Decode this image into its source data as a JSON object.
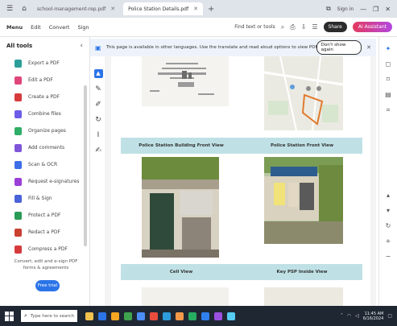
{
  "browser": {
    "tabs": [
      {
        "label": "school-management-rep.pdf",
        "active": false
      },
      {
        "label": "Police Station Details.pdf",
        "active": true
      }
    ],
    "new_tab": "+",
    "sign_in": "Sign in",
    "controls": {
      "minimize": "—",
      "restore": "❐",
      "close": "✕"
    }
  },
  "acrobat": {
    "menus": [
      "Menu",
      "Edit",
      "Convert",
      "Sign"
    ],
    "find_text": "Find text or tools",
    "share_label": "Share",
    "ai_label": "AI Assistant"
  },
  "left_panel": {
    "title": "All tools",
    "close": "‹",
    "tools": [
      {
        "label": "Export a PDF",
        "color": "#2b9e9a"
      },
      {
        "label": "Edit a PDF",
        "color": "#e0457b"
      },
      {
        "label": "Create a PDF",
        "color": "#d63a3a"
      },
      {
        "label": "Combine files",
        "color": "#6c5ce7"
      },
      {
        "label": "Organize pages",
        "color": "#2fae67"
      },
      {
        "label": "Add comments",
        "color": "#7f56d9"
      },
      {
        "label": "Scan & OCR",
        "color": "#3d6ee8"
      },
      {
        "label": "Request e-signatures",
        "color": "#9b3fd6"
      },
      {
        "label": "Fill & Sign",
        "color": "#4a63d8"
      },
      {
        "label": "Protect a PDF",
        "color": "#2a9b56"
      },
      {
        "label": "Redact a PDF",
        "color": "#c9402f"
      },
      {
        "label": "Compress a PDF",
        "color": "#d63a3a"
      }
    ],
    "promo_text": "Convert, edit and e-sign PDF forms & agreements",
    "promo_button": "Free trial"
  },
  "banner": {
    "text": "This page is available in other languages. Use the translate and read aloud options to view PDF in another language.",
    "button": "Don't show again",
    "close": "✕"
  },
  "document": {
    "captions": [
      "Police Station Building Front View",
      "Police Station Front View",
      "Cell View",
      "Key PSP Inside View"
    ]
  },
  "taskbar": {
    "search_placeholder": "Type here to search",
    "time": "11:45 AM",
    "date": "6/16/2024",
    "app_colors": [
      "#f2c14e",
      "#2b74e8",
      "#f5a623",
      "#3fa34d",
      "#4c8df6",
      "#e84d3d",
      "#2d9cdb",
      "#f2994a",
      "#27ae60",
      "#2f80ed",
      "#9b51e0",
      "#56ccf2"
    ]
  }
}
